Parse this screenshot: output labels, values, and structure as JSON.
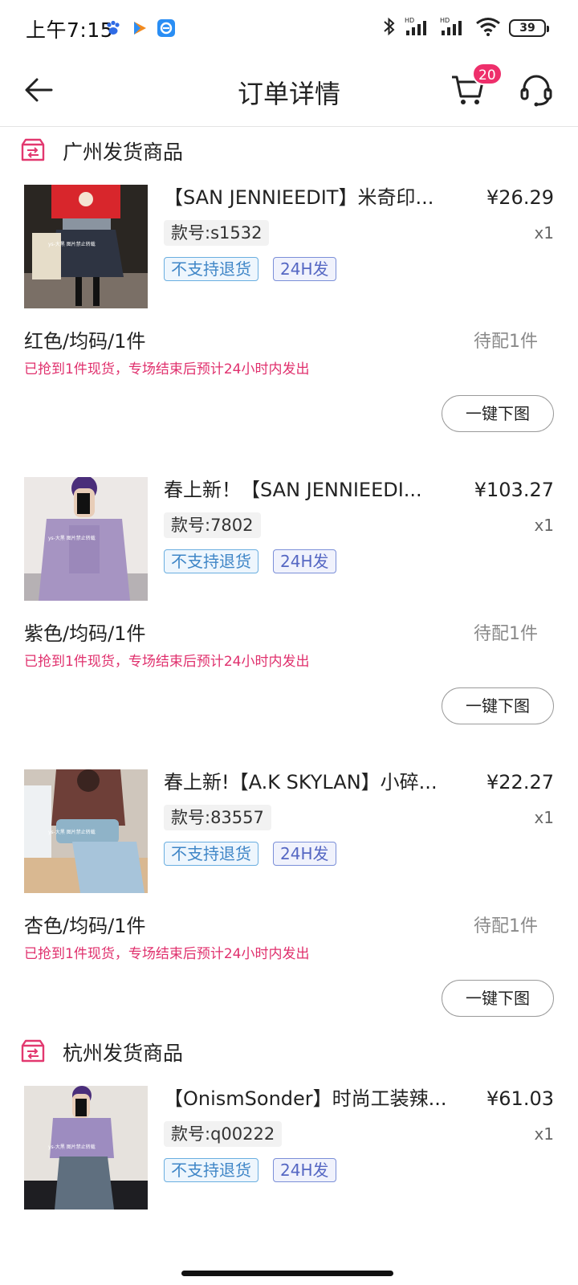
{
  "status_bar": {
    "time": "上午7:15",
    "battery": "39",
    "icons": [
      "baidu-paw-icon",
      "play-app-icon",
      "browser-app-icon",
      "bluetooth-icon",
      "hd-signal-icon",
      "hd-signal-icon",
      "wifi-icon",
      "battery-icon"
    ]
  },
  "nav": {
    "title": "订单详情",
    "cart_badge": "20",
    "icons": [
      "back-arrow-icon",
      "cart-icon",
      "customer-service-icon"
    ]
  },
  "sections": [
    {
      "title": "广州发货商品",
      "products": [
        {
          "title": "【SAN JENNIEEDIT】米奇印...",
          "price": "¥26.29",
          "code": "款号:s1532",
          "qty": "x1",
          "tags": [
            "不支持退货",
            "24H发"
          ],
          "spec": "红色/均码/1件",
          "pending": "待配1件",
          "note": "已抢到1件现货，专场结束后预计24小时内发出",
          "button": "一键下图"
        },
        {
          "title": "春上新！【SAN JENNIEEDI...",
          "price": "¥103.27",
          "code": "款号:7802",
          "qty": "x1",
          "tags": [
            "不支持退货",
            "24H发"
          ],
          "spec": "紫色/均码/1件",
          "pending": "待配1件",
          "note": "已抢到1件现货，专场结束后预计24小时内发出",
          "button": "一键下图"
        },
        {
          "title": "春上新!【A.K SKYLAN】小碎...",
          "price": "¥22.27",
          "code": "款号:83557",
          "qty": "x1",
          "tags": [
            "不支持退货",
            "24H发"
          ],
          "spec": "杏色/均码/1件",
          "pending": "待配1件",
          "note": "已抢到1件现货，专场结束后预计24小时内发出",
          "button": "一键下图"
        }
      ]
    },
    {
      "title": "杭州发货商品",
      "products": [
        {
          "title": "【OnismSonder】时尚工装辣...",
          "price": "¥61.03",
          "code": "款号:q00222",
          "qty": "x1",
          "tags": [
            "不支持退货",
            "24H发"
          ]
        }
      ]
    }
  ],
  "colors": {
    "accent_pink": "#ee2f6b",
    "note_pink": "#e0306d",
    "tag_blue": "#3f86c7",
    "tag_indigo": "#5567c3"
  }
}
